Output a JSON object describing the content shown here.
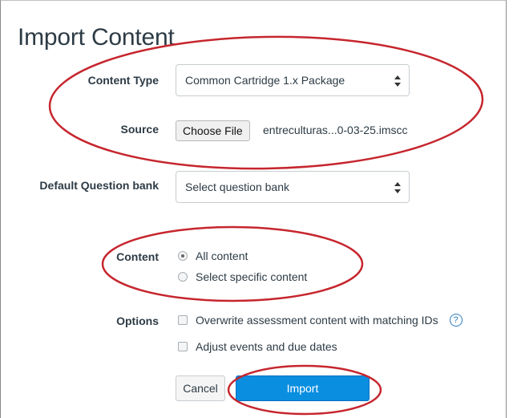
{
  "page": {
    "title": "Import Content"
  },
  "content_type": {
    "label": "Content Type",
    "selected": "Common Cartridge 1.x Package"
  },
  "source": {
    "label": "Source",
    "button_label": "Choose File",
    "file_name": "entreculturas...0-03-25.imscc"
  },
  "question_bank": {
    "label": "Default Question bank",
    "selected": "Select question bank"
  },
  "content": {
    "label": "Content",
    "options": [
      {
        "label": "All content",
        "checked": true
      },
      {
        "label": "Select specific content",
        "checked": false
      }
    ]
  },
  "options": {
    "label": "Options",
    "items": [
      {
        "label": "Overwrite assessment content with matching IDs",
        "checked": false
      },
      {
        "label": "Adjust events and due dates",
        "checked": false
      }
    ],
    "help_glyph": "?"
  },
  "actions": {
    "cancel_label": "Cancel",
    "import_label": "Import"
  },
  "colors": {
    "annotation": "#c6262e",
    "primary": "#0a8ee0",
    "help": "#2b7abc"
  }
}
